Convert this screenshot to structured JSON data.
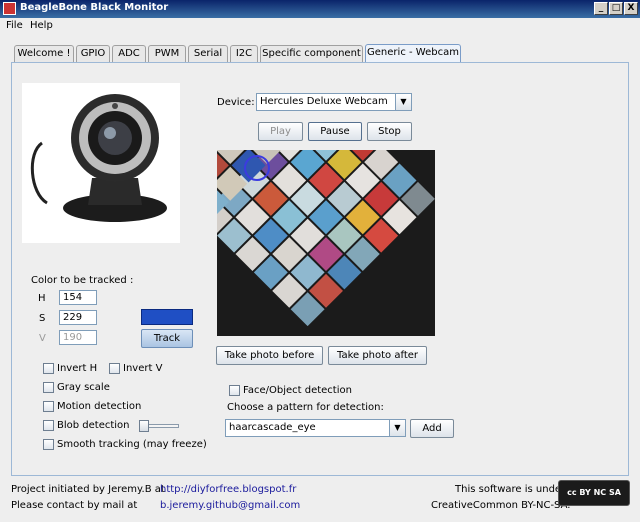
{
  "window": {
    "title": "BeagleBone Black Monitor",
    "controls": [
      "_",
      "□",
      "X"
    ]
  },
  "menu": [
    "File",
    "Help"
  ],
  "tabs": [
    "Welcome !",
    "GPIO",
    "ADC",
    "PWM",
    "Serial",
    "I2C",
    "Specific component",
    "Generic - Webcam"
  ],
  "active_tab": "Generic - Webcam",
  "device": {
    "label": "Device:",
    "selected": "Hercules Deluxe Webcam"
  },
  "playback": {
    "play": "Play",
    "pause": "Pause",
    "stop": "Stop"
  },
  "color_tracking": {
    "title": "Color to be tracked :",
    "h_label": "H",
    "h_value": "154",
    "s_label": "S",
    "s_value": "229",
    "v_label": "V",
    "v_value": "190",
    "swatch_color": "#1f4fc4",
    "track_button": "Track"
  },
  "options": {
    "invert_h": "Invert H",
    "invert_v": "Invert V",
    "gray_scale": "Gray scale",
    "motion_detection": "Motion detection",
    "blob_detection": "Blob detection",
    "smooth_tracking": "Smooth tracking (may freeze)"
  },
  "blob_slider_level": 0.0,
  "photo": {
    "before": "Take photo before",
    "after": "Take photo after"
  },
  "detection": {
    "face_object": "Face/Object detection",
    "choose_label": "Choose a pattern for detection:",
    "pattern": "haarcascade_eye",
    "add_button": "Add"
  },
  "footer": {
    "initiated": "Project initiated by Jeremy.B at",
    "site": "http://diyforfree.blogspot.fr",
    "contact": "Please contact by mail at",
    "email": "b.jeremy.github@gmail.com",
    "license_line1": "This software is under",
    "license_line2": "CreativeCommon BY-NC-SA.",
    "cc_badge": "cc BY NC SA"
  }
}
